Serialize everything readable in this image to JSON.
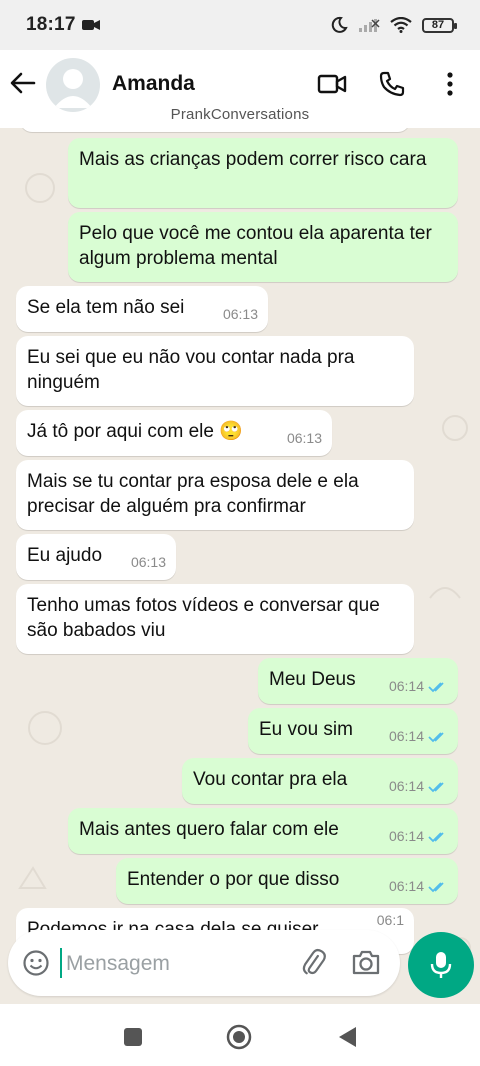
{
  "status_bar": {
    "time": "18:17",
    "battery": "87"
  },
  "header": {
    "contact_name": "Amanda",
    "watermark": "PrankConversations"
  },
  "messages": [
    {
      "direction": "out",
      "text": "Mais as crianças podem correr risco cara",
      "time": "",
      "ticks": ""
    },
    {
      "direction": "out",
      "text": "Pelo que você me contou ela aparenta ter algum problema mental",
      "time": "",
      "ticks": ""
    },
    {
      "direction": "in",
      "text": "Se ela tem não sei",
      "time": "06:13"
    },
    {
      "direction": "in",
      "text": "Eu sei que eu não vou contar nada pra ninguém",
      "time": ""
    },
    {
      "direction": "in",
      "text": "Já tô por aqui com ele 🙄",
      "time": "06:13"
    },
    {
      "direction": "in",
      "text": "Mais se tu contar pra esposa dele e ela precisar de alguém pra confirmar",
      "time": ""
    },
    {
      "direction": "in",
      "text": "Eu ajudo",
      "time": "06:13"
    },
    {
      "direction": "in",
      "text": "Tenho umas fotos vídeos e conversar que são babados viu",
      "time": ""
    },
    {
      "direction": "out",
      "text": "Meu Deus",
      "time": "06:14",
      "ticks": "read"
    },
    {
      "direction": "out",
      "text": "Eu vou sim",
      "time": "06:14",
      "ticks": "read"
    },
    {
      "direction": "out",
      "text": "Vou contar pra ela",
      "time": "06:14",
      "ticks": "read"
    },
    {
      "direction": "out",
      "text": "Mais antes quero falar com ele",
      "time": "06:14",
      "ticks": "read"
    },
    {
      "direction": "out",
      "text": "Entender o por que disso",
      "time": "06:14",
      "ticks": "read"
    },
    {
      "direction": "in",
      "text": "Podemos ir na casa dela se quiser",
      "time": "06:1"
    }
  ],
  "input": {
    "placeholder": "Mensagem"
  },
  "colors": {
    "accent": "#00a884",
    "outgoing_bubble": "#d9fdd3",
    "incoming_bubble": "#ffffff",
    "chat_background": "#efeae2",
    "read_ticks": "#53bdeb"
  },
  "icons": {
    "back": "arrow-left-icon",
    "video": "video-camera-icon",
    "call": "phone-icon",
    "menu": "more-vertical-icon",
    "emoji": "emoji-icon",
    "attach": "paperclip-icon",
    "camera": "camera-icon",
    "mic": "microphone-icon"
  }
}
